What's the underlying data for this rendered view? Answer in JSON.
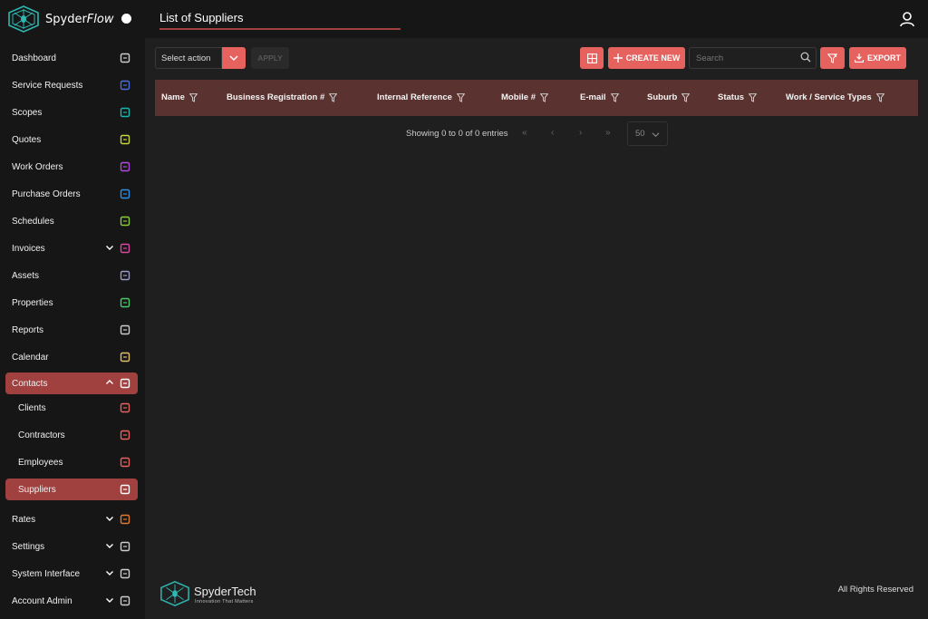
{
  "brand": {
    "name_part1": "Spyder",
    "name_part2": "Flow"
  },
  "header": {
    "title": "List of Suppliers"
  },
  "sidebar": {
    "items": [
      {
        "label": "Dashboard",
        "icon": "bar-chart-icon",
        "color": "#cccccc"
      },
      {
        "label": "Service Requests",
        "icon": "people-icon",
        "color": "#4a6fd6"
      },
      {
        "label": "Scopes",
        "icon": "scope-icon",
        "color": "#17b8b0"
      },
      {
        "label": "Quotes",
        "icon": "tools-icon",
        "color": "#c8d83a"
      },
      {
        "label": "Work Orders",
        "icon": "hammer-icon",
        "color": "#b14ad8"
      },
      {
        "label": "Purchase Orders",
        "icon": "cart-icon",
        "color": "#2d8fe0"
      },
      {
        "label": "Schedules",
        "icon": "recycle-icon",
        "color": "#8acb3a"
      },
      {
        "label": "Invoices",
        "icon": "card-icon",
        "color": "#d84aa0"
      },
      {
        "label": "Assets",
        "icon": "pulse-icon",
        "color": "#9a9ac8"
      },
      {
        "label": "Properties",
        "icon": "building-icon",
        "color": "#4ac86a"
      },
      {
        "label": "Reports",
        "icon": "trend-icon",
        "color": "#cccccc"
      },
      {
        "label": "Calendar",
        "icon": "calendar-icon",
        "color": "#e0c070"
      },
      {
        "label": "Contacts",
        "icon": "contact-icon",
        "color": "#ffffff"
      },
      {
        "label": "Clients",
        "icon": "handshake-icon",
        "color": "#e5625e"
      },
      {
        "label": "Contractors",
        "icon": "hardhat-icon",
        "color": "#e5625e"
      },
      {
        "label": "Employees",
        "icon": "user-gear-icon",
        "color": "#e5625e"
      },
      {
        "label": "Suppliers",
        "icon": "store-icon",
        "color": "#ffffff"
      },
      {
        "label": "Rates",
        "icon": "clipboard-icon",
        "color": "#e07a30"
      },
      {
        "label": "Settings",
        "icon": "gear-icon",
        "color": "#cccccc"
      },
      {
        "label": "System Interface",
        "icon": "phone-icon",
        "color": "#cccccc"
      },
      {
        "label": "Account Admin",
        "icon": "users-icon",
        "color": "#cccccc"
      }
    ]
  },
  "toolbar": {
    "select_action": "Select action",
    "apply": "APPLY",
    "create_new": "CREATE NEW",
    "search_placeholder": "Search",
    "export": "EXPORT"
  },
  "table": {
    "columns": [
      "Name",
      "Business Registration #",
      "Internal Reference",
      "Mobile #",
      "E-mail",
      "Suburb",
      "Status",
      "Work / Service Types"
    ],
    "rows": []
  },
  "pagination": {
    "summary": "Showing 0 to 0 of 0 entries",
    "first": "«",
    "prev": "‹",
    "next": "›",
    "last": "»",
    "page_size": "50"
  },
  "footer": {
    "brand": "SpyderTech",
    "tagline": "Innovation That Matters",
    "rights": "All Rights Reserved"
  },
  "colors": {
    "accent": "#e5625e",
    "active": "#a0413f",
    "table_header": "#5a3331"
  }
}
